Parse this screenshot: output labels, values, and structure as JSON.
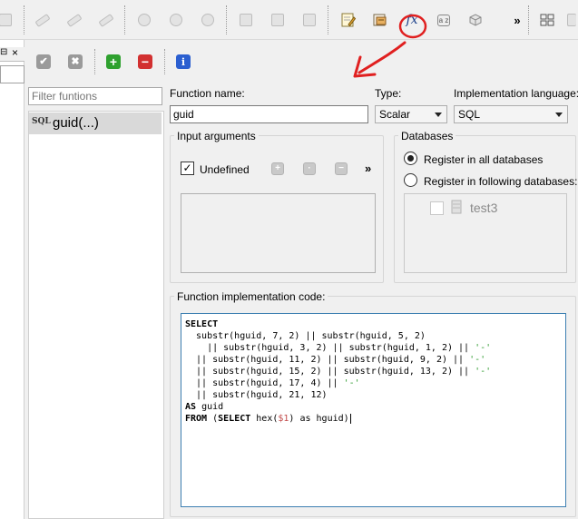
{
  "toolbar": {
    "overflow_glyph": "»",
    "function_icon_text": "fx",
    "sort_icon_text": "a z"
  },
  "left_panel": {
    "close_glyph": "×",
    "pin_glyph": "⊟"
  },
  "action_bar": {
    "commit_glyph": "✔",
    "rollback_glyph": "✖",
    "add_glyph": "+",
    "delete_glyph": "−",
    "info_glyph": "i"
  },
  "filter": {
    "placeholder": "Filter funtions"
  },
  "functions_list": {
    "items": [
      {
        "badge": "SQL",
        "label": "guid(...)"
      }
    ]
  },
  "form": {
    "function_name_label": "Function name:",
    "function_name_value": "guid",
    "type_label": "Type:",
    "type_value": "Scalar",
    "impl_lang_label": "Implementation language:",
    "impl_lang_value": "SQL"
  },
  "input_arguments": {
    "title": "Input arguments",
    "undefined_label": "Undefined",
    "undefined_checked": true,
    "overflow_glyph": "»"
  },
  "databases": {
    "title": "Databases",
    "option_all": "Register in all databases",
    "option_following": "Register in following databases:",
    "selected": "all",
    "db_items": [
      "test3"
    ]
  },
  "code": {
    "title": "Function implementation code:",
    "lines": [
      "SELECT",
      "  substr(hguid, 7, 2) || substr(hguid, 5, 2)",
      "    || substr(hguid, 3, 2) || substr(hguid, 1, 2) || '-'",
      "  || substr(hguid, 11, 2) || substr(hguid, 9, 2) || '-'",
      "  || substr(hguid, 15, 2) || substr(hguid, 13, 2) || '-'",
      "  || substr(hguid, 17, 4) || '-'",
      "  || substr(hguid, 21, 12)",
      "AS guid",
      "FROM (SELECT hex($1) as hguid)"
    ]
  },
  "colors": {
    "accent_blue": "#3c7fb1",
    "annotation_red": "#e02020",
    "add_green": "#2fa12f",
    "delete_red": "#d23030",
    "info_blue": "#2b5fd0",
    "string_green": "#2e9a2e"
  }
}
